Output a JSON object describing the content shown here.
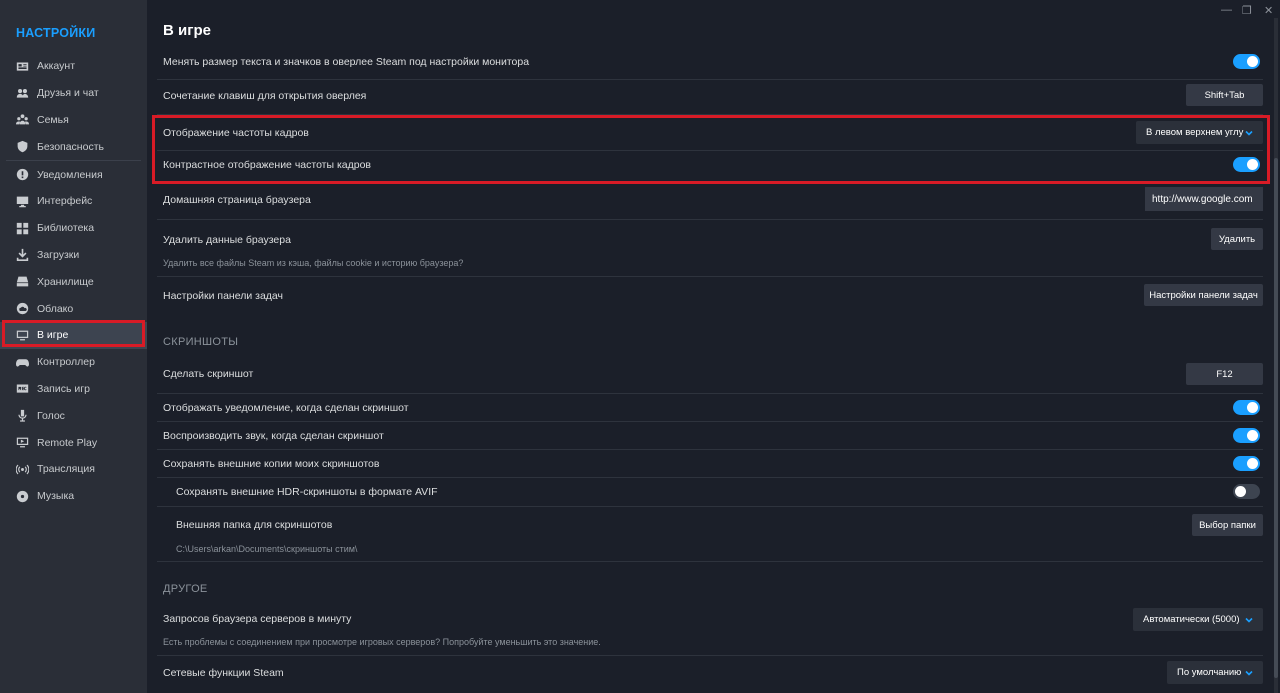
{
  "sidebar": {
    "title": "НАСТРОЙКИ",
    "items": [
      {
        "label": "Аккаунт",
        "icon": "account-card-icon"
      },
      {
        "label": "Друзья и чат",
        "icon": "friends-icon"
      },
      {
        "label": "Семья",
        "icon": "family-icon"
      },
      {
        "label": "Безопасность",
        "icon": "shield-icon"
      },
      {
        "label": "Уведомления",
        "icon": "alert-icon"
      },
      {
        "label": "Интерфейс",
        "icon": "monitor-icon"
      },
      {
        "label": "Библиотека",
        "icon": "grid-icon"
      },
      {
        "label": "Загрузки",
        "icon": "download-icon"
      },
      {
        "label": "Хранилище",
        "icon": "storage-icon"
      },
      {
        "label": "Облако",
        "icon": "cloud-icon"
      },
      {
        "label": "В игре",
        "icon": "ingame-icon"
      },
      {
        "label": "Контроллер",
        "icon": "gamepad-icon"
      },
      {
        "label": "Запись игр",
        "icon": "rec-icon"
      },
      {
        "label": "Голос",
        "icon": "mic-icon"
      },
      {
        "label": "Remote Play",
        "icon": "remote-play-icon"
      },
      {
        "label": "Трансляция",
        "icon": "broadcast-icon"
      },
      {
        "label": "Музыка",
        "icon": "music-icon"
      }
    ],
    "active_index": 10
  },
  "window": {
    "minimize": "—",
    "restore": "❐",
    "close": "✕"
  },
  "page": {
    "title": "В игре"
  },
  "settings": {
    "overlay_scale": {
      "label": "Менять размер текста и значков в оверлее Steam под настройки монитора",
      "on": true
    },
    "overlay_hotkey": {
      "label": "Сочетание клавиш для открытия оверлея",
      "value": "Shift+Tab"
    },
    "fps_display": {
      "label": "Отображение частоты кадров",
      "value": "В левом верхнем углу"
    },
    "fps_contrast": {
      "label": "Контрастное отображение частоты кадров",
      "on": true
    },
    "browser_home": {
      "label": "Домашняя страница браузера",
      "value": "http://www.google.com"
    },
    "browser_delete": {
      "label": "Удалить данные браузера",
      "button": "Удалить",
      "desc": "Удалить все файлы Steam из кэша, файлы cookie и историю браузера?"
    },
    "taskbar": {
      "label": "Настройки панели задач",
      "button": "Настройки панели задач"
    }
  },
  "screenshots": {
    "heading": "СКРИНШОТЫ",
    "take": {
      "label": "Сделать скриншот",
      "value": "F12"
    },
    "notify": {
      "label": "Отображать уведомление, когда сделан скриншот",
      "on": true
    },
    "sound": {
      "label": "Воспроизводить звук, когда сделан скриншот",
      "on": true
    },
    "external": {
      "label": "Сохранять внешние копии моих скриншотов",
      "on": true
    },
    "hdr_avif": {
      "label": "Сохранять внешние HDR-скриншоты в формате AVIF",
      "on": false
    },
    "folder": {
      "label": "Внешняя папка для скриншотов",
      "button": "Выбор папки",
      "path": "C:\\Users\\arkan\\Documents\\скриншоты стим\\"
    }
  },
  "other": {
    "heading": "ДРУГОЕ",
    "server_requests": {
      "label": "Запросов браузера серверов в минуту",
      "value": "Автоматически (5000)",
      "desc": "Есть проблемы с соединением при просмотре игровых серверов? Попробуйте уменьшить это значение."
    },
    "network": {
      "label": "Сетевые функции Steam",
      "value": "По умолчанию"
    }
  },
  "colors": {
    "accent": "#1a9fff",
    "highlight": "#d81b26",
    "bg": "#1b1f29",
    "sidebar": "#2a2e37"
  }
}
